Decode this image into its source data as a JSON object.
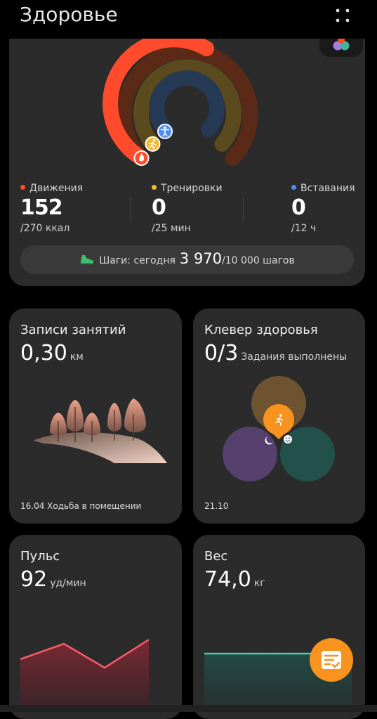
{
  "header": {
    "title": "Здоровье",
    "menu_icon": "more-vertical-icon"
  },
  "activity": {
    "move": {
      "label": "Движения",
      "value": "152",
      "goal": "/270 ккал",
      "color": "#ff4b2b",
      "progress": 0.56
    },
    "exercise": {
      "label": "Тренировки",
      "value": "0",
      "goal": "/25 мин",
      "color": "#f5b82e",
      "progress": 0
    },
    "stand": {
      "label": "Вставания",
      "value": "0",
      "goal": "/12 ч",
      "color": "#4d8cf5",
      "progress": 0
    },
    "steps": {
      "label": "Шаги: сегодня",
      "count": "3 970",
      "goal": "/10 000 шагов"
    }
  },
  "exercise_tile": {
    "title": "Записи занятий",
    "value": "0,30",
    "unit": "км",
    "footer": "16.04  Ходьба в помещении"
  },
  "clover_tile": {
    "title": "Клевер здоровья",
    "value": "0/3",
    "unit": "Задания выполнены",
    "footer": "21.10"
  },
  "pulse_tile": {
    "title": "Пульс",
    "value": "92",
    "unit": "уд/мин"
  },
  "weight_tile": {
    "title": "Вес",
    "value": "74,0",
    "unit": "кг"
  },
  "fab": {
    "icon": "notes-checklist-icon"
  }
}
